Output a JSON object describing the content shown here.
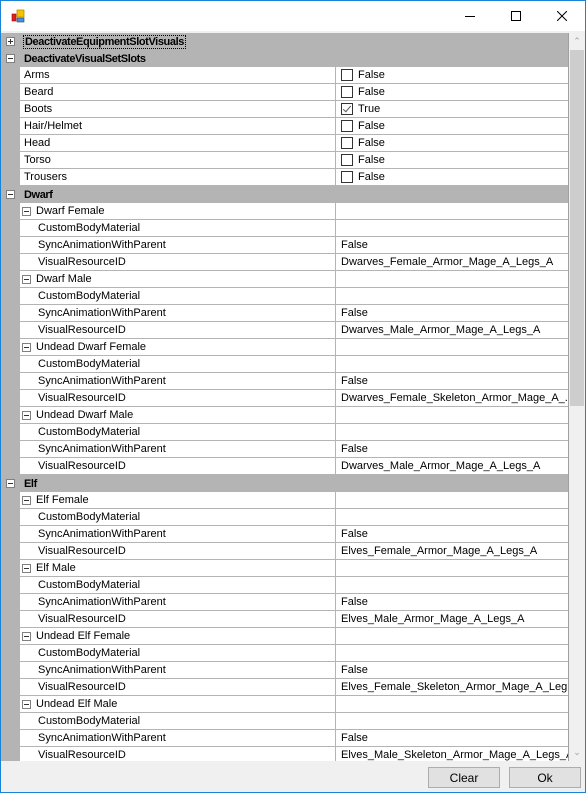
{
  "window": {
    "title": "",
    "icon": "property-grid-app-icon",
    "controls": {
      "minimize": "minimize-icon",
      "maximize": "maximize-icon",
      "close": "close-icon"
    }
  },
  "grid": {
    "categories": [
      {
        "label": "DeactivateEquipmentSlotVisuals",
        "expanded": false,
        "selected": true,
        "properties": []
      },
      {
        "label": "DeactivateVisualSetSlots",
        "expanded": true,
        "properties": [
          {
            "name": "Arms",
            "value": "False",
            "checked": false
          },
          {
            "name": "Beard",
            "value": "False",
            "checked": false
          },
          {
            "name": "Boots",
            "value": "True",
            "checked": true
          },
          {
            "name": "Hair/Helmet",
            "value": "False",
            "checked": false
          },
          {
            "name": "Head",
            "value": "False",
            "checked": false
          },
          {
            "name": "Torso",
            "value": "False",
            "checked": false
          },
          {
            "name": "Trousers",
            "value": "False",
            "checked": false
          }
        ]
      },
      {
        "label": "Dwarf",
        "expanded": true,
        "groups": [
          {
            "label": "Dwarf Female",
            "props": [
              {
                "name": "CustomBodyMaterial",
                "value": ""
              },
              {
                "name": "SyncAnimationWithParent",
                "value": "False"
              },
              {
                "name": "VisualResourceID",
                "value": "Dwarves_Female_Armor_Mage_A_Legs_A"
              }
            ]
          },
          {
            "label": "Dwarf Male",
            "props": [
              {
                "name": "CustomBodyMaterial",
                "value": ""
              },
              {
                "name": "SyncAnimationWithParent",
                "value": "False"
              },
              {
                "name": "VisualResourceID",
                "value": "Dwarves_Male_Armor_Mage_A_Legs_A"
              }
            ]
          },
          {
            "label": "Undead Dwarf Female",
            "props": [
              {
                "name": "CustomBodyMaterial",
                "value": ""
              },
              {
                "name": "SyncAnimationWithParent",
                "value": "False"
              },
              {
                "name": "VisualResourceID",
                "value": "Dwarves_Female_Skeleton_Armor_Mage_A_..."
              }
            ]
          },
          {
            "label": "Undead Dwarf Male",
            "props": [
              {
                "name": "CustomBodyMaterial",
                "value": ""
              },
              {
                "name": "SyncAnimationWithParent",
                "value": "False"
              },
              {
                "name": "VisualResourceID",
                "value": "Dwarves_Male_Armor_Mage_A_Legs_A"
              }
            ]
          }
        ]
      },
      {
        "label": "Elf",
        "expanded": true,
        "groups": [
          {
            "label": "Elf Female",
            "props": [
              {
                "name": "CustomBodyMaterial",
                "value": ""
              },
              {
                "name": "SyncAnimationWithParent",
                "value": "False"
              },
              {
                "name": "VisualResourceID",
                "value": "Elves_Female_Armor_Mage_A_Legs_A"
              }
            ]
          },
          {
            "label": "Elf Male",
            "props": [
              {
                "name": "CustomBodyMaterial",
                "value": ""
              },
              {
                "name": "SyncAnimationWithParent",
                "value": "False"
              },
              {
                "name": "VisualResourceID",
                "value": "Elves_Male_Armor_Mage_A_Legs_A"
              }
            ]
          },
          {
            "label": "Undead Elf Female",
            "props": [
              {
                "name": "CustomBodyMaterial",
                "value": ""
              },
              {
                "name": "SyncAnimationWithParent",
                "value": "False"
              },
              {
                "name": "VisualResourceID",
                "value": "Elves_Female_Skeleton_Armor_Mage_A_Leg..."
              }
            ]
          },
          {
            "label": "Undead Elf Male",
            "props": [
              {
                "name": "CustomBodyMaterial",
                "value": ""
              },
              {
                "name": "SyncAnimationWithParent",
                "value": "False"
              },
              {
                "name": "VisualResourceID",
                "value": "Elves_Male_Skeleton_Armor_Mage_A_Legs_A"
              }
            ]
          }
        ]
      }
    ]
  },
  "scroll": {
    "position_fraction": 0.0,
    "visible_fraction": 0.5
  },
  "buttons": {
    "clear": "Clear",
    "ok": "Ok"
  }
}
